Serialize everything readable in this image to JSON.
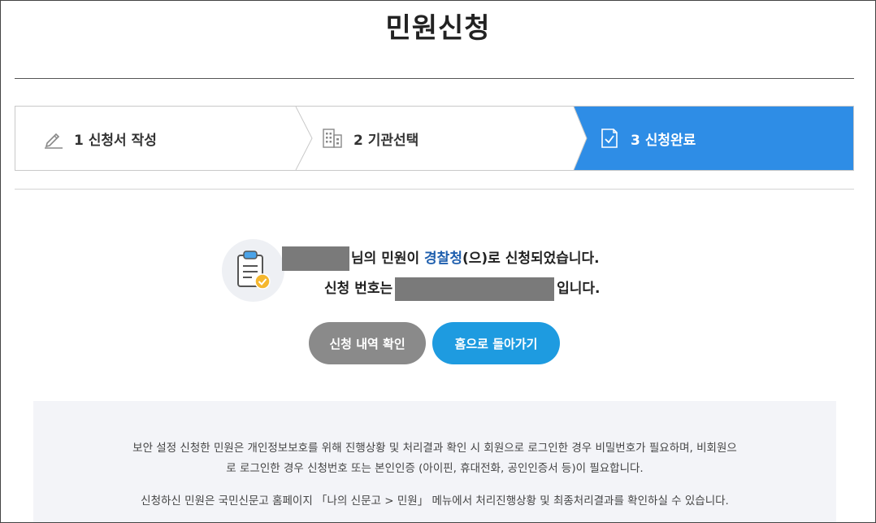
{
  "page": {
    "title": "민원신청"
  },
  "steps": [
    {
      "label": "1 신청서 작성",
      "icon": "pencil-icon",
      "state": "done"
    },
    {
      "label": "2 기관선택",
      "icon": "building-icon",
      "state": "done"
    },
    {
      "label": "3 신청완료",
      "icon": "document-check-icon",
      "state": "active"
    }
  ],
  "colors": {
    "accent": "#2e8de6",
    "agency": "#1f5fae",
    "button_gray": "#8a8a8a",
    "button_blue": "#1e9be0"
  },
  "result": {
    "line1_suffix": "님의 민원이 ",
    "agency": "경찰청",
    "line1_tail": "(으)로 신청되었습니다.",
    "line2_prefix": "신청 번호는",
    "line2_suffix": "입니다."
  },
  "buttons": {
    "history": "신청 내역 확인",
    "home": "홈으로 돌아가기"
  },
  "notice": {
    "line1": "보안 설정 신청한 민원은 개인정보보호를 위해 진행상황 및 처리결과 확인 시 회원으로 로그인한 경우 비밀번호가 필요하며, 비회원으",
    "line2": "로 로그인한 경우 신청번호 또는 본인인증 (아이핀, 휴대전화, 공인인증서 등)이 필요합니다.",
    "line3": "신청하신 민원은 국민신문고 홈페이지 「나의 신문고 > 민원」 메뉴에서 처리진행상황 및 최종처리결과를 확인하실 수 있습니다."
  }
}
